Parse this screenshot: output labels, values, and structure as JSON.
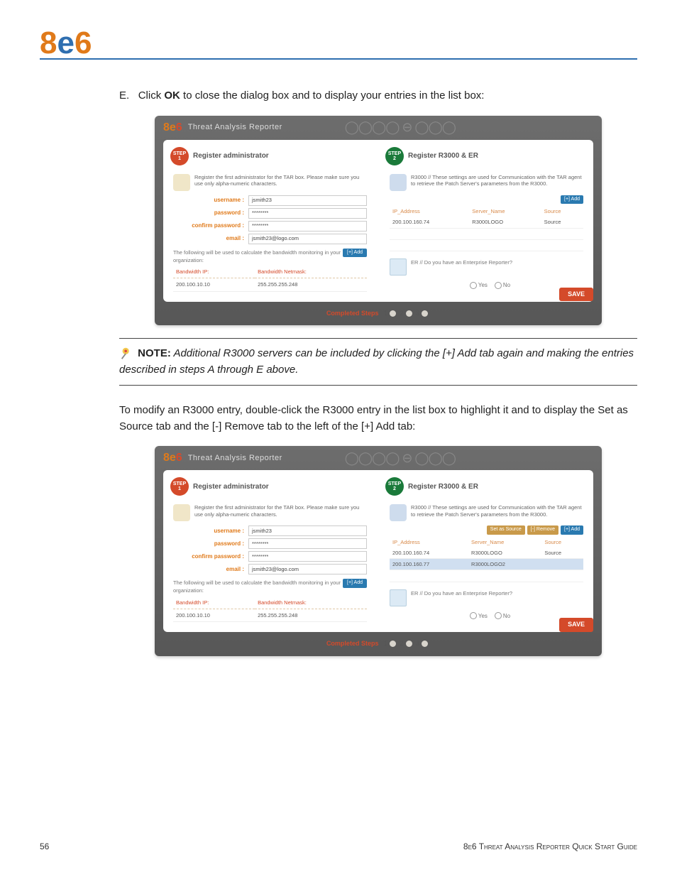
{
  "page_number": "56",
  "footer_title": "8e6 Threat Analysis Reporter Quick Start Guide",
  "logo": {
    "text": "8e6"
  },
  "instruction_E": {
    "letter": "E.",
    "prefix": "Click ",
    "bold": "OK",
    "suffix": " to close the dialog box and to display your entries in the list box:"
  },
  "note": {
    "label": "NOTE:",
    "text": " Additional R3000 servers can be included by clicking the [+] Add tab again and making the entries described in steps A through E above."
  },
  "para_modify": "To modify an R3000 entry, double-click the R3000 entry in the list box to highlight it and to display the Set as Source tab and the [-] Remove tab to the left of the [+] Add tab:",
  "fig_common": {
    "brand_product": "Threat Analysis Reporter",
    "step1_label": "STEP",
    "step1_num": "1",
    "step1_title": "Register administrator",
    "step2_label": "STEP",
    "step2_num": "2",
    "step2_title": "Register R3000 & ER",
    "admin_intro": "Register the first administrator for the TAR box. Please make sure you use only alpha-numeric characters.",
    "r3000_intro": "R3000 // These settings are used for Communication with the TAR agent to retrieve the Patch Server's parameters from the R3000.",
    "labels": {
      "username": "username :",
      "password": "password :",
      "confirm": "confirm password :",
      "email": "email :"
    },
    "values": {
      "username": "jsmith23",
      "password": "********",
      "confirm": "********",
      "email": "jsmith23@logo.com"
    },
    "bw_note": "The following will be used to calculate the bandwidth monitoring in your organization:",
    "add_tab": "[+] Add",
    "bw_headers": {
      "ip": "Bandwidth IP:",
      "mask": "Bandwidth Netmask:"
    },
    "bw_row": {
      "ip": "200.100.10.10",
      "mask": "255.255.255.248"
    },
    "r3000_headers": {
      "ip": "IP_Address",
      "name": "Server_Name",
      "src": "Source"
    },
    "er_question": "ER // Do you have an Enterprise Reporter?",
    "yes": "Yes",
    "no": "No",
    "save": "SAVE",
    "completed": "Completed Steps",
    "steps": [
      "1",
      "2",
      "3"
    ]
  },
  "fig1": {
    "actions": {
      "add": "[+] Add"
    },
    "rows": [
      {
        "ip": "200.100.160.74",
        "name": "R3000LOGO",
        "src": "Source",
        "selected": false
      }
    ]
  },
  "fig2": {
    "actions": {
      "src": "Set as Source",
      "rem": "[-] Remove",
      "add": "[+] Add"
    },
    "rows": [
      {
        "ip": "200.100.160.74",
        "name": "R3000LOGO",
        "src": "Source",
        "selected": false
      },
      {
        "ip": "200.100.160.77",
        "name": "R3000LOGO2",
        "src": "",
        "selected": true
      }
    ]
  }
}
